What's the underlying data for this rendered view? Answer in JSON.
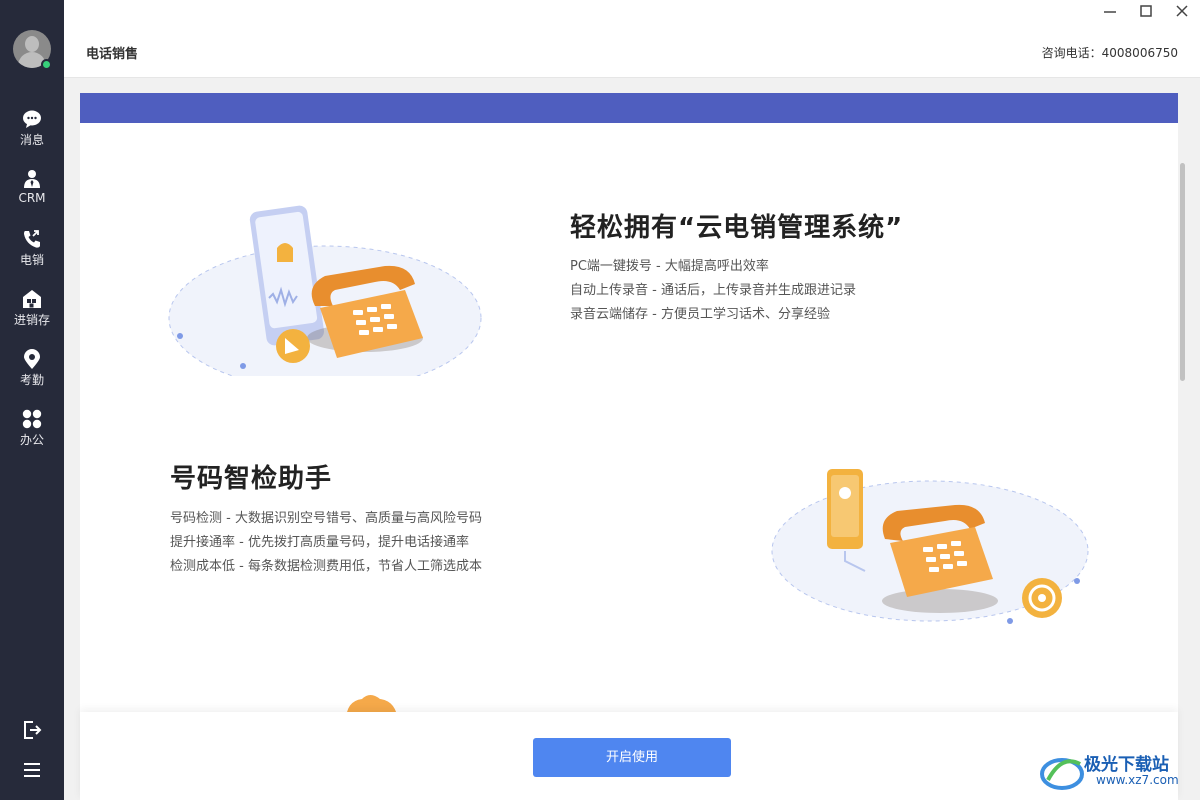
{
  "sidebar": {
    "items": [
      {
        "label": "消息",
        "icon": "chat-icon"
      },
      {
        "label": "CRM",
        "icon": "crm-person-icon"
      },
      {
        "label": "电销",
        "icon": "phone-call-icon"
      },
      {
        "label": "进销存",
        "icon": "warehouse-icon"
      },
      {
        "label": "考勤",
        "icon": "location-pin-icon"
      },
      {
        "label": "办公",
        "icon": "grid-apps-icon"
      }
    ],
    "bottom_icons": [
      "logout-icon",
      "menu-icon"
    ]
  },
  "window": {
    "controls": [
      "minimize-icon",
      "maximize-icon",
      "close-icon"
    ]
  },
  "header": {
    "title": "电话销售",
    "phone": "咨询电话：4008006750"
  },
  "features": [
    {
      "title": "轻松拥有“云电销管理系统”",
      "lines": [
        "PC端一键拨号 - 大幅提高呼出效率",
        "自动上传录音 - 通话后，上传录音并生成跟进记录",
        "录音云端储存 - 方便员工学习话术、分享经验"
      ]
    },
    {
      "title": "号码智检助手",
      "lines": [
        "号码检测 - 大数据识别空号错号、高质量与高风险号码",
        "提升接通率 - 优先拨打高质量号码，提升电话接通率",
        "检测成本低 - 每条数据检测费用低，节省人工筛选成本"
      ]
    }
  ],
  "footer": {
    "start_button": "开启使用"
  },
  "watermark": {
    "name": "极光下载站",
    "url": "www.xz7.com"
  },
  "colors": {
    "sidebar_bg": "#262a3a",
    "banner": "#4f5ebf",
    "accent_button": "#4f86f0",
    "phone_orange": "#f5a94a",
    "online": "#37d07a"
  }
}
